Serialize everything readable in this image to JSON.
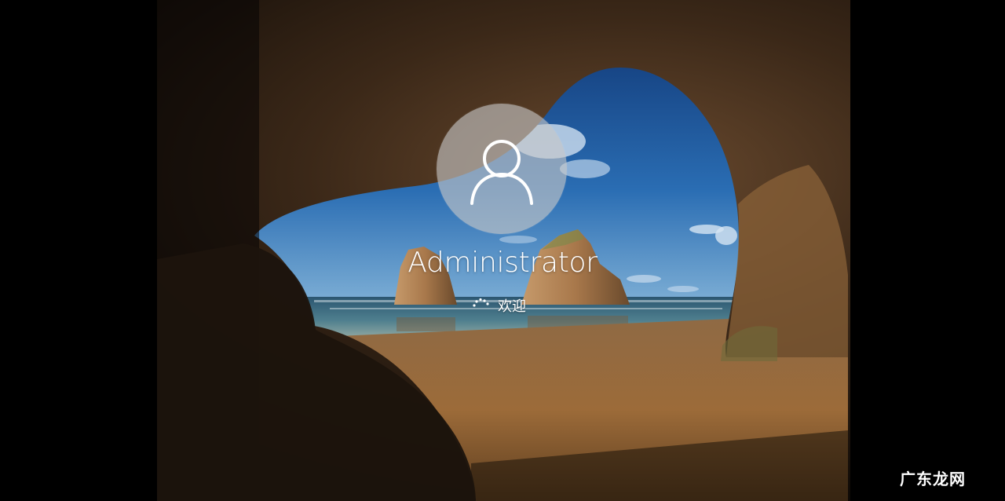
{
  "signin": {
    "username": "Administrator",
    "status": "欢迎",
    "avatar_icon": "user-icon",
    "spinner_icon": "loading-spinner-icon"
  },
  "watermark": {
    "text": "广东龙网"
  },
  "colors": {
    "background": "#000000",
    "sky": "#1f5fa8",
    "sand": "#9a6a37",
    "rock": "#3a2a1e",
    "text": "#ffffff"
  }
}
